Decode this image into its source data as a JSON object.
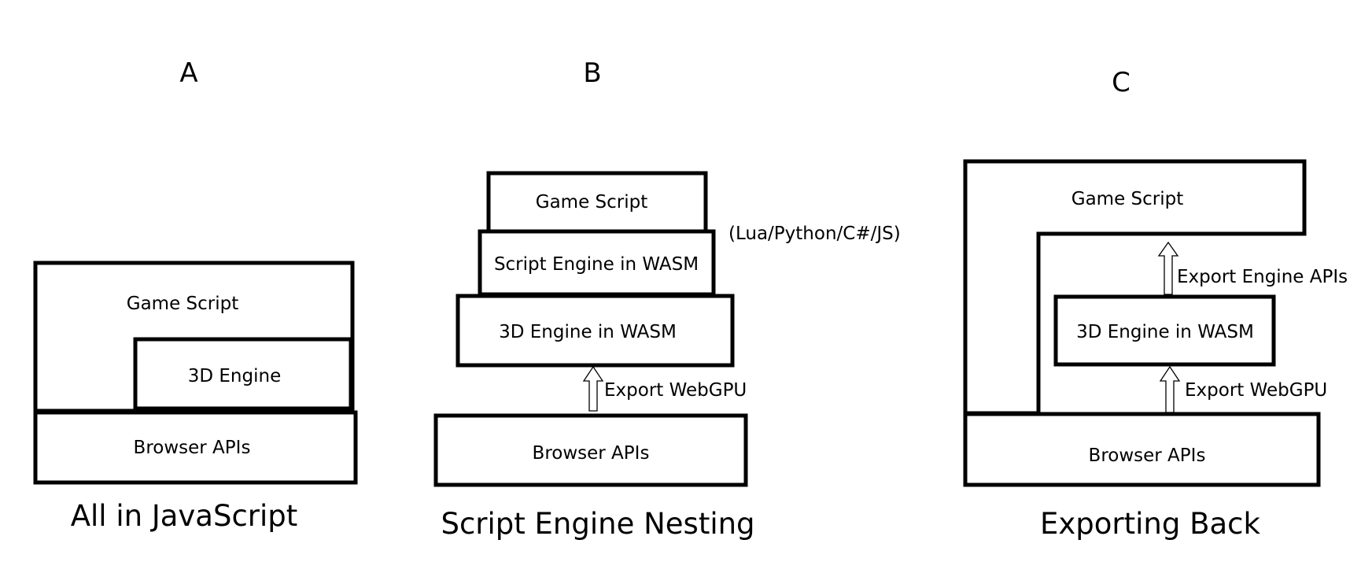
{
  "panels": [
    {
      "letter": "A",
      "caption": "All in JavaScript",
      "layers": {
        "game_script": "Game Script",
        "engine": "3D Engine",
        "browser": "Browser APIs"
      }
    },
    {
      "letter": "B",
      "caption": "Script Engine Nesting",
      "layers": {
        "game_script": "Game Script",
        "script_engine": "Script Engine in WASM",
        "engine": "3D Engine in WASM",
        "browser": "Browser APIs"
      },
      "script_languages": "(Lua/Python/C#/JS)",
      "arrows": {
        "webgpu": "Export WebGPU"
      }
    },
    {
      "letter": "C",
      "caption": "Exporting Back",
      "layers": {
        "game_script": "Game Script",
        "engine": "3D Engine in WASM",
        "browser": "Browser APIs"
      },
      "arrows": {
        "engine_apis": "Export Engine APIs",
        "webgpu": "Export WebGPU"
      }
    }
  ],
  "colors": {
    "stroke": "#000000",
    "background": "#ffffff"
  }
}
